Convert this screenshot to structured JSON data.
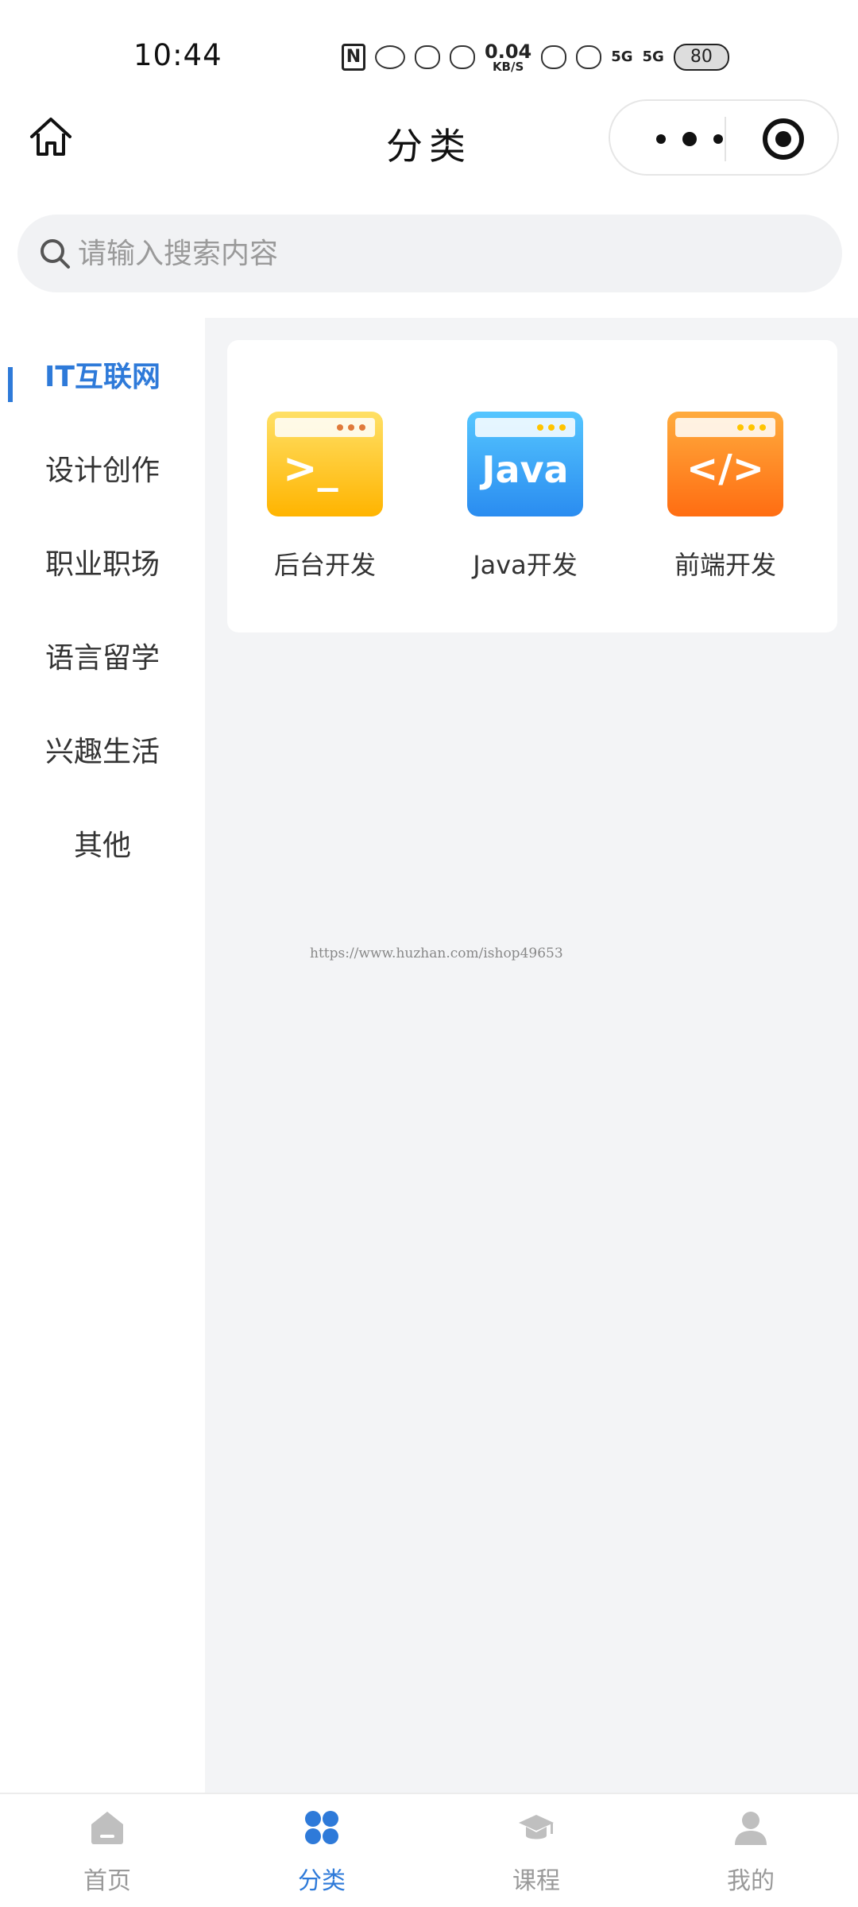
{
  "status_bar": {
    "time": "10:44",
    "speed_value": "0.04",
    "speed_unit": "KB/S",
    "signal_1": "5G",
    "signal_2": "5G",
    "battery": "80"
  },
  "nav": {
    "title": "分类"
  },
  "search": {
    "placeholder": "请输入搜索内容"
  },
  "sidebar": {
    "items": [
      {
        "label": "IT互联网",
        "active": true
      },
      {
        "label": "设计创作"
      },
      {
        "label": "职业职场"
      },
      {
        "label": "语言留学"
      },
      {
        "label": "兴趣生活"
      },
      {
        "label": "其他"
      }
    ]
  },
  "categories": [
    {
      "label": "后台开发",
      "icon": "terminal-icon",
      "glyph": ">_",
      "color_top": "#ffe066",
      "color_bottom": "#ffb400"
    },
    {
      "label": "Java开发",
      "icon": "java-icon",
      "glyph": "Java",
      "color_top": "#55c6ff",
      "color_bottom": "#2a8cf0"
    },
    {
      "label": "前端开发",
      "icon": "code-icon",
      "glyph": "</>",
      "color_top": "#ffab3d",
      "color_bottom": "#ff6d12"
    }
  ],
  "watermark": "https://www.huzhan.com/ishop49653",
  "tabbar": {
    "items": [
      {
        "label": "首页",
        "icon": "home-icon"
      },
      {
        "label": "分类",
        "icon": "category-icon",
        "active": true
      },
      {
        "label": "课程",
        "icon": "graduation-cap-icon"
      },
      {
        "label": "我的",
        "icon": "user-icon"
      }
    ]
  },
  "colors": {
    "accent": "#2e7ad9",
    "content_bg": "#f3f4f6",
    "inactive_tab": "#999999"
  }
}
